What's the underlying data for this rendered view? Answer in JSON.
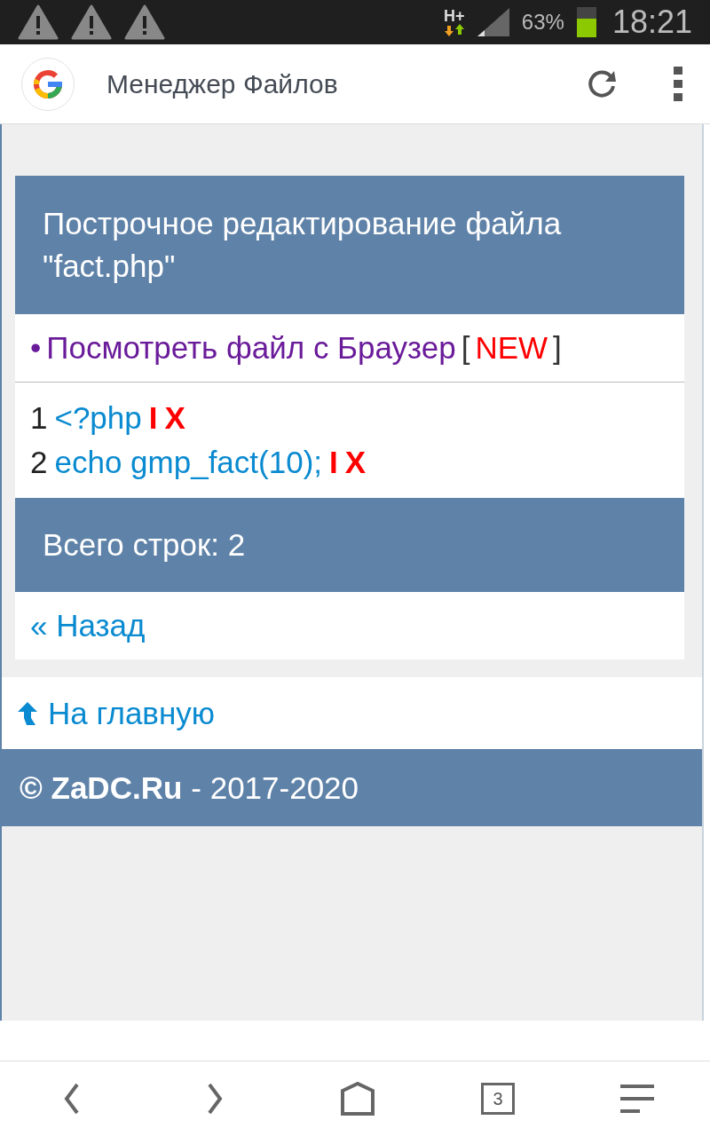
{
  "status_bar": {
    "network": "H+",
    "battery": "63%",
    "time": "18:21"
  },
  "browser": {
    "title": "Менеджер Файлов"
  },
  "page": {
    "heading": "Построчное редактирование файла \"fact.php\"",
    "view_link": {
      "bullet": "•",
      "text": "Посмотреть файл с Браузер",
      "open": "[",
      "badge": "NEW",
      "close": "]"
    },
    "lines": [
      {
        "number": "1",
        "code": "<?php",
        "edit": "I",
        "delete": "X"
      },
      {
        "number": "2",
        "code": "echo gmp_fact(10);",
        "edit": "I",
        "delete": "X"
      }
    ],
    "total": "Всего строк: 2",
    "back": "« Назад",
    "home": "На главную",
    "footer": {
      "brand": "© ZaDC.Ru",
      "years": "- 2017-2020"
    }
  },
  "bottom_nav": {
    "tabs_count": "3"
  }
}
